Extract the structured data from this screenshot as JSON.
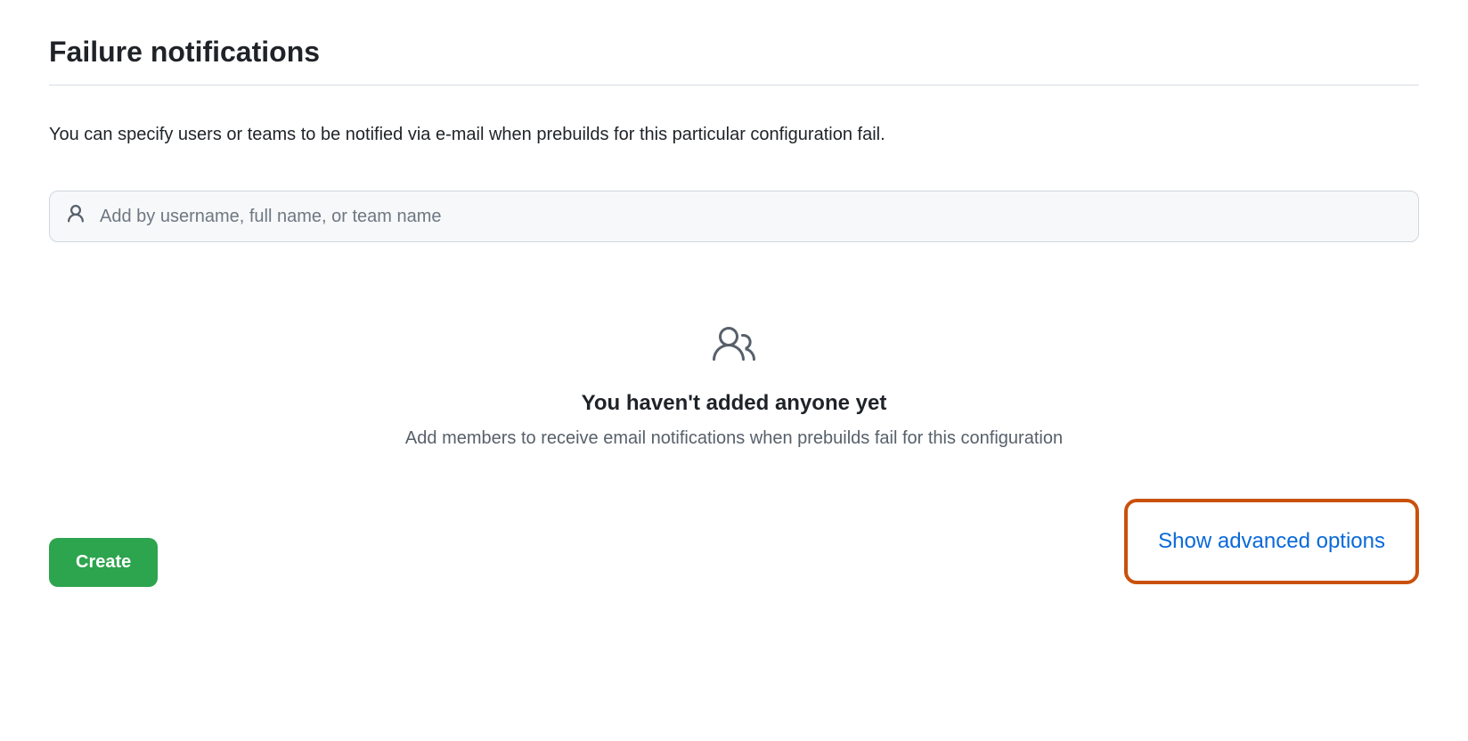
{
  "header": {
    "title": "Failure notifications"
  },
  "description": "You can specify users or teams to be notified via e-mail when prebuilds for this particular configuration fail.",
  "search": {
    "placeholder": "Add by username, full name, or team name",
    "value": ""
  },
  "emptyState": {
    "title": "You haven't added anyone yet",
    "subtitle": "Add members to receive email notifications when prebuilds fail for this configuration"
  },
  "buttons": {
    "create": "Create",
    "advanced": "Show advanced options"
  }
}
